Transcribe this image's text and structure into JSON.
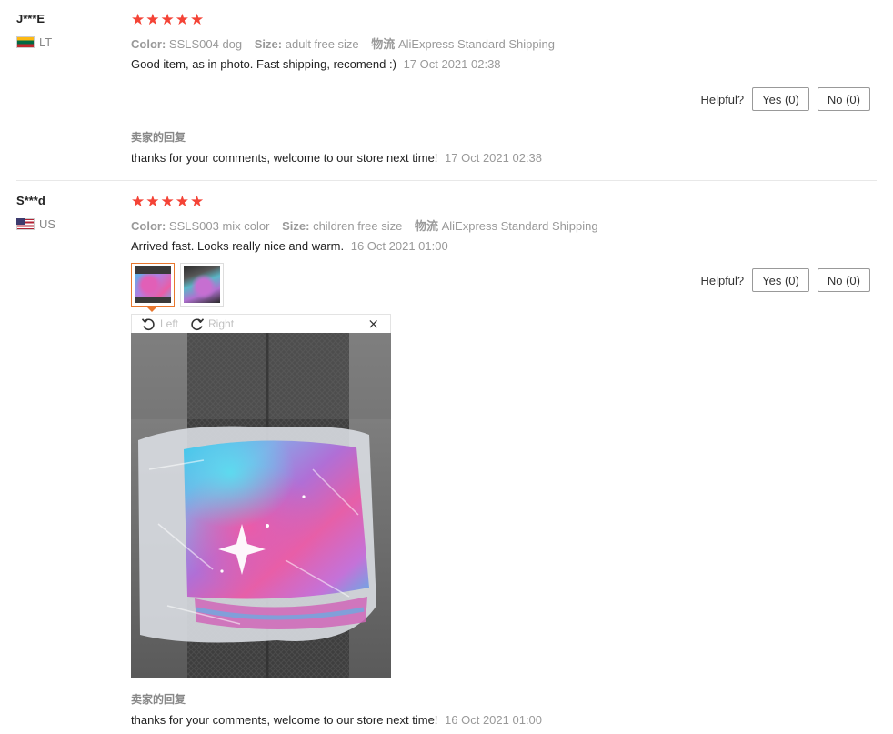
{
  "reviews": [
    {
      "user": "J***E",
      "country": "LT",
      "rating": 5,
      "color_label": "Color:",
      "color_value": "SSLS004 dog",
      "size_label": "Size:",
      "size_value": "adult free size",
      "logistics_label": "物流",
      "logistics_value": "AliExpress Standard Shipping",
      "text": "Good item, as in photo. Fast shipping, recomend :)",
      "date": "17 Oct 2021 02:38",
      "helpful_label": "Helpful?",
      "yes_label": "Yes (0)",
      "no_label": "No (0)",
      "seller_title": "卖家的回复",
      "seller_reply": "thanks for your comments, welcome to our store next time!",
      "seller_date": "17 Oct 2021 02:38"
    },
    {
      "user": "S***d",
      "country": "US",
      "rating": 5,
      "color_label": "Color:",
      "color_value": "SSLS003 mix color",
      "size_label": "Size:",
      "size_value": "children free size",
      "logistics_label": "物流",
      "logistics_value": "AliExpress Standard Shipping",
      "text": "Arrived fast. Looks really nice and warm.",
      "date": "16 Oct 2021 01:00",
      "helpful_label": "Helpful?",
      "yes_label": "Yes (0)",
      "no_label": "No (0)",
      "viewer": {
        "rotate_left_label": "Left",
        "rotate_right_label": "Right",
        "close_icon": "×"
      },
      "seller_title": "卖家的回复",
      "seller_reply": "thanks for your comments, welcome to our store next time!",
      "seller_date": "16 Oct 2021 01:00"
    }
  ],
  "colors": {
    "star": "#f44336",
    "thumb_selected": "#e8772e"
  }
}
